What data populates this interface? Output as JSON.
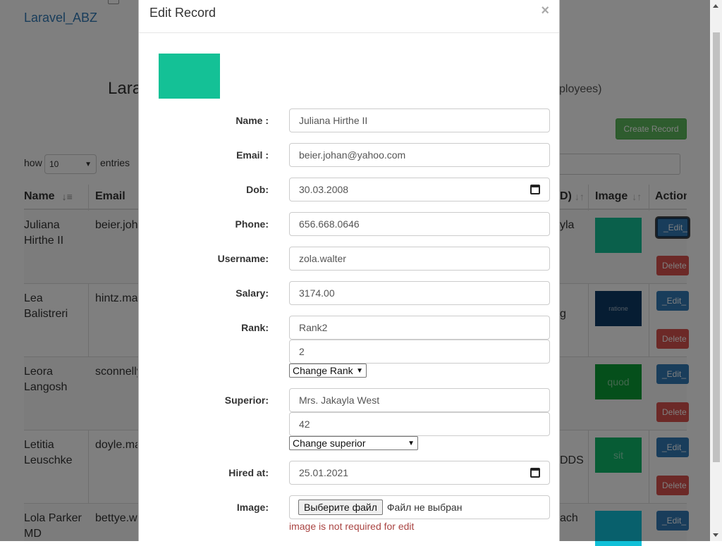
{
  "brand": "Laravel_ABZ",
  "page": {
    "title_left": "Lara",
    "title_right": "ployees)",
    "create_button": "Create Record",
    "show_label": "how",
    "entries_value": "10",
    "entries_label": "entries"
  },
  "table": {
    "headers": {
      "name": "Name",
      "email": "Email",
      "superior": "D)",
      "image": "Image",
      "actions": "Action"
    },
    "rows": [
      {
        "name": "Juliana Hirthe II",
        "email": "beier.joh",
        "superior": "yla",
        "image_text": "",
        "image_color": "#14c196",
        "edit": "_Edit_",
        "delete": "Delete"
      },
      {
        "name": "Lea Balistreri",
        "email": "hintz.ma",
        "superior": "g",
        "image_text": "ratione",
        "image_color": "#0d3b66",
        "edit": "_Edit_",
        "delete": "Delete"
      },
      {
        "name": "Leora Langosh",
        "email": "sconnelly",
        "superior": "",
        "image_text": "quod",
        "image_color": "#0a9e36",
        "edit": "_Edit_",
        "delete": "Delete"
      },
      {
        "name": "Letitia Leuschke",
        "email": "doyle.ma",
        "superior": "DDS",
        "image_text": "sit",
        "image_color": "#0fb86a",
        "edit": "_Edit_",
        "delete": "Delete"
      },
      {
        "name": "Lola Parker MD",
        "email": "bettye.wa",
        "superior": "ach",
        "image_text": "",
        "image_color": "#10c0d8",
        "edit": "_Edit_",
        "delete": "Delete"
      }
    ]
  },
  "modal": {
    "title": "Edit Record",
    "close": "×",
    "preview_text": "",
    "fields": {
      "name": {
        "label": "Name :",
        "value": "Juliana Hirthe II"
      },
      "email": {
        "label": "Email :",
        "value": "beier.johan@yahoo.com"
      },
      "dob": {
        "label": "Dob:",
        "value": "30.03.2008"
      },
      "phone": {
        "label": "Phone:",
        "value": "656.668.0646"
      },
      "username": {
        "label": "Username:",
        "value": "zola.walter"
      },
      "salary": {
        "label": "Salary:",
        "value": "3174.00"
      },
      "rank": {
        "label": "Rank:",
        "value": "Rank2",
        "id_value": "2",
        "select_label": "Change Rank"
      },
      "superior": {
        "label": "Superior:",
        "value": "Mrs. Jakayla West",
        "id_value": "42",
        "select_label": "Change superior"
      },
      "hired_at": {
        "label": "Hired at:",
        "value": "25.01.2021"
      },
      "image": {
        "label": "Image:",
        "button": "Выберите файл",
        "status": "Файл не выбран",
        "help": "image is not required for edit"
      }
    }
  },
  "colors": {
    "primary": "#337ab7",
    "success": "#5cb85c",
    "danger": "#d9534f",
    "error_text": "#a94442"
  }
}
